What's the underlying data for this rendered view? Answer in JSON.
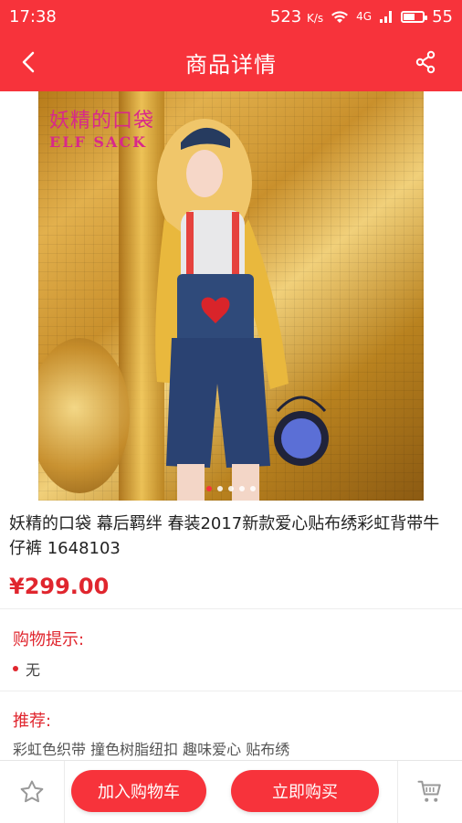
{
  "status": {
    "time": "17:38",
    "speed": "523",
    "speed_unit": "K/s",
    "network": "4G",
    "battery": "55"
  },
  "header": {
    "title": "商品详情",
    "back_icon": "back-arrow-icon",
    "share_icon": "share-icon"
  },
  "product": {
    "brand_cn": "妖精的口袋",
    "brand_en": "ELF SACK",
    "name": "妖精的口袋 幕后羁绊 春装2017新款爱心贴布绣彩虹背带牛仔裤 1648103",
    "price": "¥299.00",
    "image_dots": 5,
    "active_dot": 0
  },
  "tips": {
    "title": "购物提示:",
    "item": "无"
  },
  "recommend": {
    "title": "推荐:",
    "text": "彩虹色织带 撞色树脂纽扣 趣味爱心 贴布绣"
  },
  "bottom": {
    "favorite_icon": "star-icon",
    "add_to_cart": "加入购物车",
    "buy_now": "立即购买",
    "cart_icon": "cart-icon"
  },
  "colors": {
    "accent": "#f7333b",
    "price": "#e0262e"
  }
}
